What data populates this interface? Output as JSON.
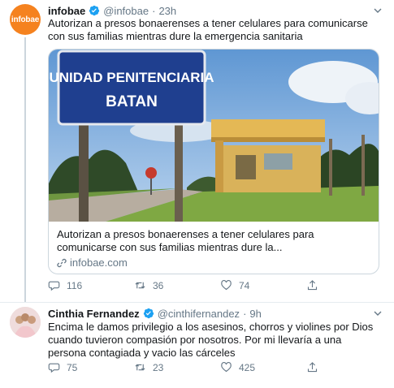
{
  "tweets": [
    {
      "name": "infobae",
      "handle": "@infobae",
      "separator": "·",
      "time": "23h",
      "avatar_text": "infobae",
      "text": "Autorizan a presos bonaerenses a tener celulares para comunicarse con sus familias mientras dure la emergencia sanitaria",
      "card": {
        "sign_line1": "UNIDAD PENITENCIARIA",
        "sign_line2": "BATAN",
        "title": "Autorizan a presos bonaerenses a tener celulares para comunicarse con sus familias mientras dure la...",
        "domain": "infobae.com"
      },
      "replies": "116",
      "retweets": "36",
      "likes": "74"
    },
    {
      "name": "Cinthia Fernandez",
      "handle": "@cinthifernandez",
      "separator": "·",
      "time": "9h",
      "text": "Encima le damos privilegio a los  asesinos, chorros y violines  por Dios cuando tuvieron compasión por nosotros. Por mi llevaría a una persona contagiada y vacio las cárceles",
      "replies": "75",
      "retweets": "23",
      "likes": "425"
    }
  ],
  "colors": {
    "text": "#14171a",
    "secondary": "#657786",
    "verified": "#1da1f2",
    "border": "#ccd6dd",
    "infobae_orange": "#f5821f"
  },
  "icons": [
    "verified-badge-icon",
    "chevron-down-icon",
    "link-icon",
    "reply-icon",
    "retweet-icon",
    "like-icon",
    "share-icon"
  ]
}
